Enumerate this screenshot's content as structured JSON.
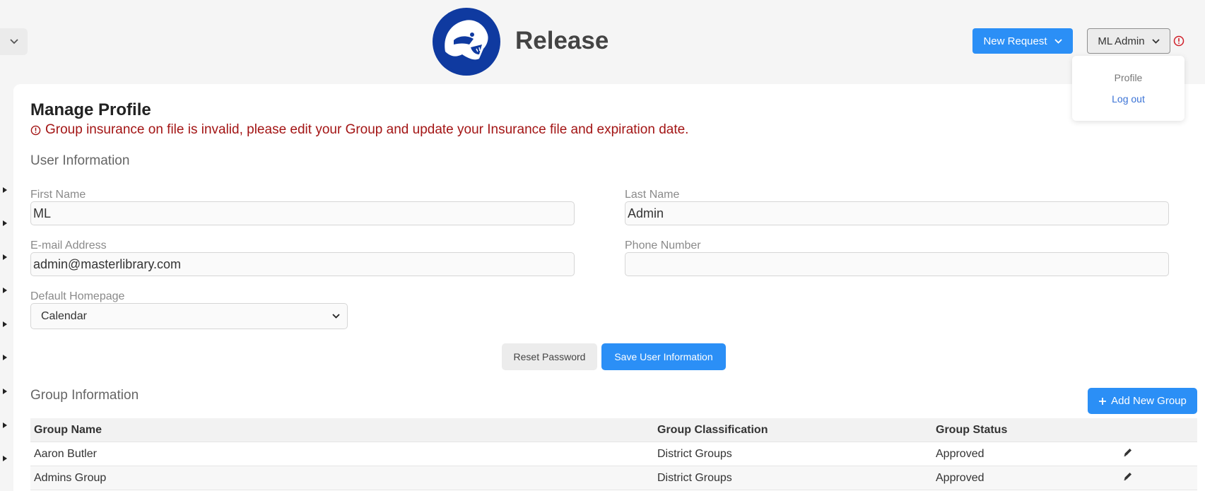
{
  "header": {
    "brand_title": "Release",
    "new_request_label": "New Request",
    "user_label": "ML Admin"
  },
  "user_menu": {
    "profile_label": "Profile",
    "logout_label": "Log out"
  },
  "page": {
    "title": "Manage Profile",
    "warning": "Group insurance on file is invalid, please edit your Group and update your Insurance file and expiration date."
  },
  "user_info": {
    "section_title": "User Information",
    "first_name_label": "First Name",
    "first_name_value": "ML",
    "last_name_label": "Last Name",
    "last_name_value": "Admin",
    "email_label": "E-mail Address",
    "email_value": "admin@masterlibrary.com",
    "phone_label": "Phone Number",
    "phone_value": "",
    "homepage_label": "Default Homepage",
    "homepage_value": "Calendar",
    "reset_password_label": "Reset Password",
    "save_label": "Save User Information"
  },
  "group_info": {
    "section_title": "Group Information",
    "add_group_label": "Add New Group",
    "columns": [
      "Group Name",
      "Group Classification",
      "Group Status"
    ],
    "rows": [
      {
        "name": "Aaron Butler",
        "classification": "District Groups",
        "status": "Approved"
      },
      {
        "name": "Admins Group",
        "classification": "District Groups",
        "status": "Approved"
      }
    ]
  },
  "colors": {
    "accent": "#2b8ff6",
    "warning": "#a31515",
    "logo_blue": "#0f3aa0"
  }
}
